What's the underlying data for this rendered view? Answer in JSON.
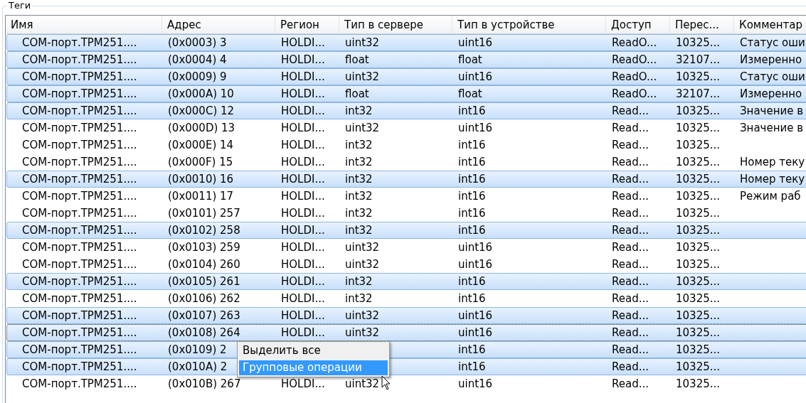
{
  "group_title": "Теги",
  "columns": [
    "Имя",
    "Адрес",
    "Регион",
    "Тип в сервере",
    "Тип в устройстве",
    "Доступ",
    "Перес...",
    "Комментар"
  ],
  "rows": [
    {
      "selected": true,
      "focused": false,
      "cells": [
        "COM-порт.ТРМ251....",
        "(0x0003) 3",
        "HOLDI...",
        "uint32",
        "uint16",
        "ReadO...",
        "10325...",
        "Статус оши"
      ]
    },
    {
      "selected": true,
      "focused": false,
      "cells": [
        "COM-порт.ТРМ251....",
        "(0x0004) 4",
        "HOLDI...",
        "float",
        "float",
        "ReadO...",
        "32107...",
        "Измеренно"
      ]
    },
    {
      "selected": true,
      "focused": false,
      "cells": [
        "COM-порт.ТРМ251....",
        "(0x0009) 9",
        "HOLDI...",
        "uint32",
        "uint16",
        "ReadO...",
        "10325...",
        "Статус оши"
      ]
    },
    {
      "selected": true,
      "focused": false,
      "cells": [
        "COM-порт.ТРМ251....",
        "(0x000A) 10",
        "HOLDI...",
        "float",
        "float",
        "ReadO...",
        "32107...",
        "Измеренно"
      ]
    },
    {
      "selected": true,
      "focused": false,
      "cells": [
        "COM-порт.ТРМ251....",
        "(0x000C) 12",
        "HOLDI...",
        "int32",
        "int16",
        "Read...",
        "10325...",
        "Значение в"
      ]
    },
    {
      "selected": false,
      "focused": false,
      "cells": [
        "COM-порт.ТРМ251....",
        "(0x000D) 13",
        "HOLDI...",
        "uint32",
        "uint16",
        "Read...",
        "10325...",
        "Значение в"
      ]
    },
    {
      "selected": false,
      "focused": false,
      "cells": [
        "COM-порт.ТРМ251....",
        "(0x000E) 14",
        "HOLDI...",
        "int32",
        "int16",
        "Read...",
        "10325...",
        null
      ]
    },
    {
      "selected": false,
      "focused": false,
      "cells": [
        "COM-порт.ТРМ251....",
        "(0x000F) 15",
        "HOLDI...",
        "int32",
        "int16",
        "Read...",
        "10325...",
        "Номер теку"
      ]
    },
    {
      "selected": true,
      "focused": false,
      "cells": [
        "COM-порт.ТРМ251....",
        "(0x0010) 16",
        "HOLDI...",
        "int32",
        "int16",
        "Read...",
        "10325...",
        "Номер теку"
      ]
    },
    {
      "selected": false,
      "focused": false,
      "cells": [
        "COM-порт.ТРМ251....",
        "(0x0011) 17",
        "HOLDI...",
        "int32",
        "int16",
        "Read...",
        "10325...",
        "Режим раб"
      ]
    },
    {
      "selected": false,
      "focused": false,
      "cells": [
        "COM-порт.ТРМ251....",
        "(0x0101) 257",
        "HOLDI...",
        "int32",
        "int16",
        "Read...",
        "10325...",
        null
      ]
    },
    {
      "selected": true,
      "focused": false,
      "cells": [
        "COM-порт.ТРМ251....",
        "(0x0102) 258",
        "HOLDI...",
        "int32",
        "int16",
        "Read...",
        "10325...",
        null
      ]
    },
    {
      "selected": false,
      "focused": false,
      "cells": [
        "COM-порт.ТРМ251....",
        "(0x0103) 259",
        "HOLDI...",
        "uint32",
        "uint16",
        "Read...",
        "10325...",
        null
      ]
    },
    {
      "selected": false,
      "focused": false,
      "cells": [
        "COM-порт.ТРМ251....",
        "(0x0104) 260",
        "HOLDI...",
        "uint32",
        "uint16",
        "Read...",
        "10325...",
        null
      ]
    },
    {
      "selected": true,
      "focused": false,
      "cells": [
        "COM-порт.ТРМ251....",
        "(0x0105) 261",
        "HOLDI...",
        "int32",
        "int16",
        "Read...",
        "10325...",
        null
      ]
    },
    {
      "selected": false,
      "focused": false,
      "cells": [
        "COM-порт.ТРМ251....",
        "(0x0106) 262",
        "HOLDI...",
        "int32",
        "int16",
        "Read...",
        "10325...",
        null
      ]
    },
    {
      "selected": true,
      "focused": false,
      "cells": [
        "COM-порт.ТРМ251....",
        "(0x0107) 263",
        "HOLDI...",
        "uint32",
        "uint16",
        "Read...",
        "10325...",
        null
      ]
    },
    {
      "selected": true,
      "focused": true,
      "cells": [
        "COM-порт.ТРМ251....",
        "(0x0108) 264",
        "HOLDI...",
        "uint32",
        "uint16",
        "Read...",
        "10325...",
        null
      ]
    },
    {
      "selected": true,
      "focused": false,
      "cells": [
        "COM-порт.ТРМ251....",
        "(0x0109) 2",
        null,
        null,
        "int16",
        "Read...",
        "10325...",
        null
      ]
    },
    {
      "selected": true,
      "focused": false,
      "cells": [
        "COM-порт.ТРМ251....",
        "(0x010A) 2",
        null,
        null,
        "int16",
        "Read...",
        "10325...",
        null
      ]
    },
    {
      "selected": false,
      "focused": false,
      "cells": [
        "COM-порт.ТРМ251....",
        "(0x010B) 267",
        "HOLDI...",
        "uint32",
        "uint16",
        "Read...",
        "10325...",
        null
      ]
    }
  ],
  "context_menu": [
    {
      "label": "Выделить все",
      "selected": false
    },
    {
      "label": "Групповые операции",
      "selected": true
    }
  ]
}
